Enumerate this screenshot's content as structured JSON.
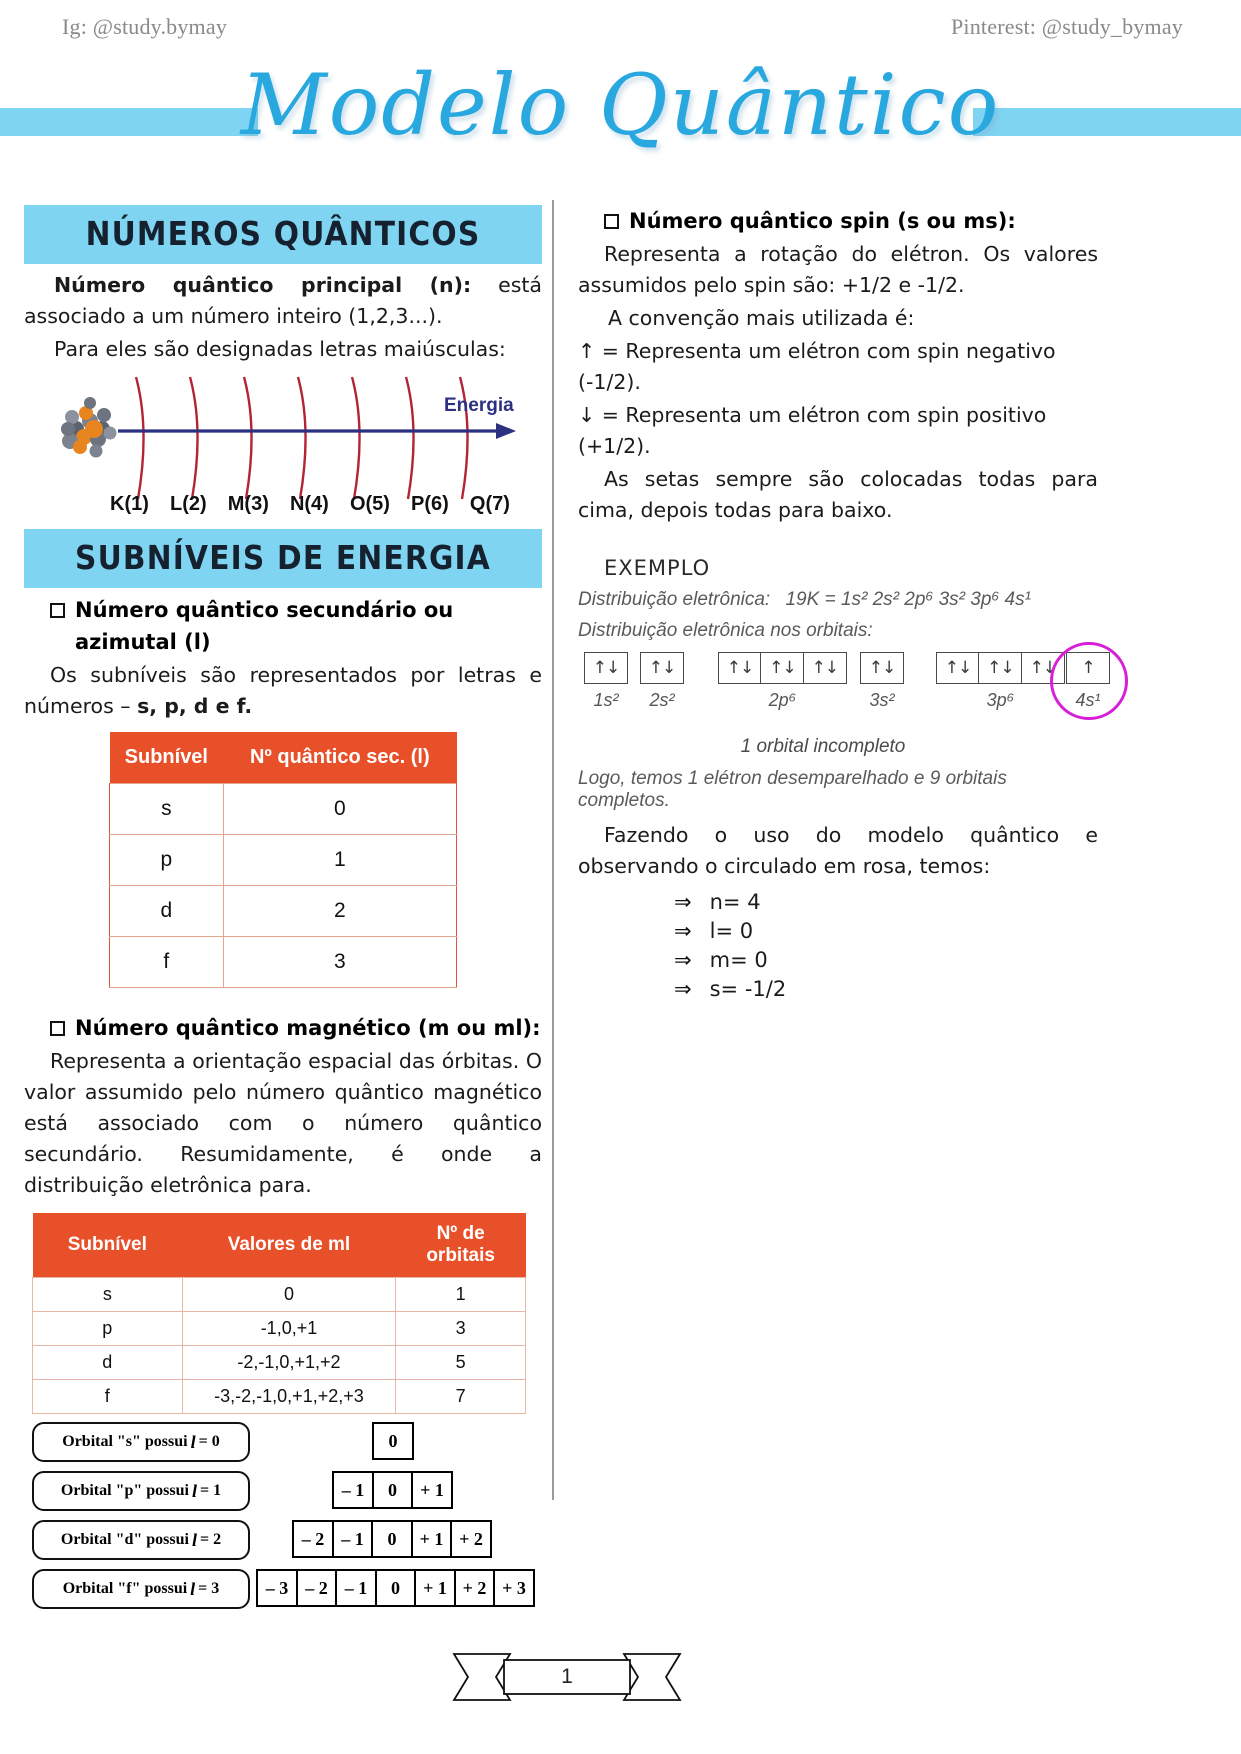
{
  "header": {
    "instagram": "Ig: @study.bymay",
    "pinterest": "Pinterest: @study_bymay"
  },
  "title": "Modelo Quântico",
  "sections": {
    "numeros_quanticos": {
      "banner": "NÚMEROS QUÂNTICOS",
      "p1_bold": "Número quântico principal (n):",
      "p1_rest": " está associado a um número inteiro (1,2,3...).",
      "p2": "Para eles são designadas letras maiúsculas:",
      "energy_label": "Energia",
      "shells": [
        "K(1)",
        "L(2)",
        "M(3)",
        "N(4)",
        "O(5)",
        "P(6)",
        "Q(7)"
      ]
    },
    "subniveis": {
      "banner": "SUBNÍVEIS DE ENERGIA",
      "bullet": "Número quântico secundário ou azimutal (l)",
      "p1": "Os subníveis são representados por letras e números – ",
      "p1_bold": "s, p, d e f.",
      "table": {
        "headers": [
          "Subnível",
          "Nº quântico sec. (l)"
        ],
        "rows": [
          [
            "s",
            "0"
          ],
          [
            "p",
            "1"
          ],
          [
            "d",
            "2"
          ],
          [
            "f",
            "3"
          ]
        ]
      }
    },
    "magnetico": {
      "bullet": "Número quântico magnético (m ou ml):",
      "p1": "Representa a orientação espacial das órbitas. O valor assumido pelo número quântico magnético está associado com o número quântico secundário. Resumidamente, é onde a distribuição eletrônica para.",
      "table": {
        "headers": [
          "Subnível",
          "Valores de ml",
          "Nº de orbitais"
        ],
        "rows": [
          [
            "s",
            "0",
            "1"
          ],
          [
            "p",
            "-1,0,+1",
            "3"
          ],
          [
            "d",
            "-2,-1,0,+1,+2",
            "5"
          ],
          [
            "f",
            "-3,-2,-1,0,+1,+2,+3",
            "7"
          ]
        ]
      },
      "orbital_shapes": [
        {
          "label_pre": "Orbital \"s\"  possui",
          "label_var": "l",
          "label_post": "=  0",
          "boxes": [
            "0"
          ]
        },
        {
          "label_pre": "Orbital \"p\"  possui",
          "label_var": "l",
          "label_post": "=  1",
          "boxes": [
            "– 1",
            "0",
            "+ 1"
          ]
        },
        {
          "label_pre": "Orbital \"d\"  possui",
          "label_var": "l",
          "label_post": "=  2",
          "boxes": [
            "– 2",
            "– 1",
            "0",
            "+ 1",
            "+ 2"
          ]
        },
        {
          "label_pre": "Orbital \"f\"  possui",
          "label_var": "l",
          "label_post": "=  3",
          "boxes": [
            "– 3",
            "– 2",
            "– 1",
            "0",
            "+ 1",
            "+ 2",
            "+ 3"
          ]
        }
      ]
    },
    "spin": {
      "bullet": "Número quântico spin (s ou ms):",
      "p1": "Representa a rotação do elétron. Os valores assumidos pelo spin são: +1/2 e -1/2.",
      "p2": "A convenção mais utilizada é:",
      "up_rule": "↑ = Representa um elétron com spin negativo (-1/2).",
      "down_rule": "↓ = Representa um elétron com spin positivo (+1/2).",
      "p3": "As setas sempre são colocadas todas para cima, depois todas para baixo."
    },
    "exemplo": {
      "title": "EXEMPLO",
      "dist_label": "Distribuição eletrônica:",
      "dist_value": "19K = 1s² 2s² 2p⁶ 3s² 3p⁶ 4s¹",
      "orbitais_label": "Distribuição eletrônica nos orbitais:",
      "orbital_groups": [
        {
          "label": "1s²",
          "cells": [
            "↑↓"
          ],
          "circled": false
        },
        {
          "label": "2s²",
          "cells": [
            "↑↓"
          ],
          "circled": false
        },
        {
          "label": "2p⁶",
          "cells": [
            "↑↓",
            "↑↓",
            "↑↓"
          ],
          "circled": false
        },
        {
          "label": "3s²",
          "cells": [
            "↑↓"
          ],
          "circled": false
        },
        {
          "label": "3p⁶",
          "cells": [
            "↑↓",
            "↑↓",
            "↑↓"
          ],
          "circled": false
        },
        {
          "label": "4s¹",
          "cells": [
            "↑"
          ],
          "circled": true
        }
      ],
      "incompleto": "1 orbital incompleto",
      "logo_line": "Logo, temos 1 elétron desemparelhado e 9 orbitais completos.",
      "conclusion": "Fazendo o uso do modelo quântico e observando o circulado em rosa, temos:",
      "results": [
        "n= 4",
        "l= 0",
        "m= 0",
        "s= -1/2"
      ]
    }
  },
  "footer": {
    "page_number": "1"
  },
  "colors": {
    "accent_blue": "#7fd4f2",
    "title_blue": "#29a8df",
    "table_header": "#e8502a",
    "pink_circle": "#d81fd8",
    "arrow_navy": "#2c3080",
    "shell_red": "#b32435"
  }
}
